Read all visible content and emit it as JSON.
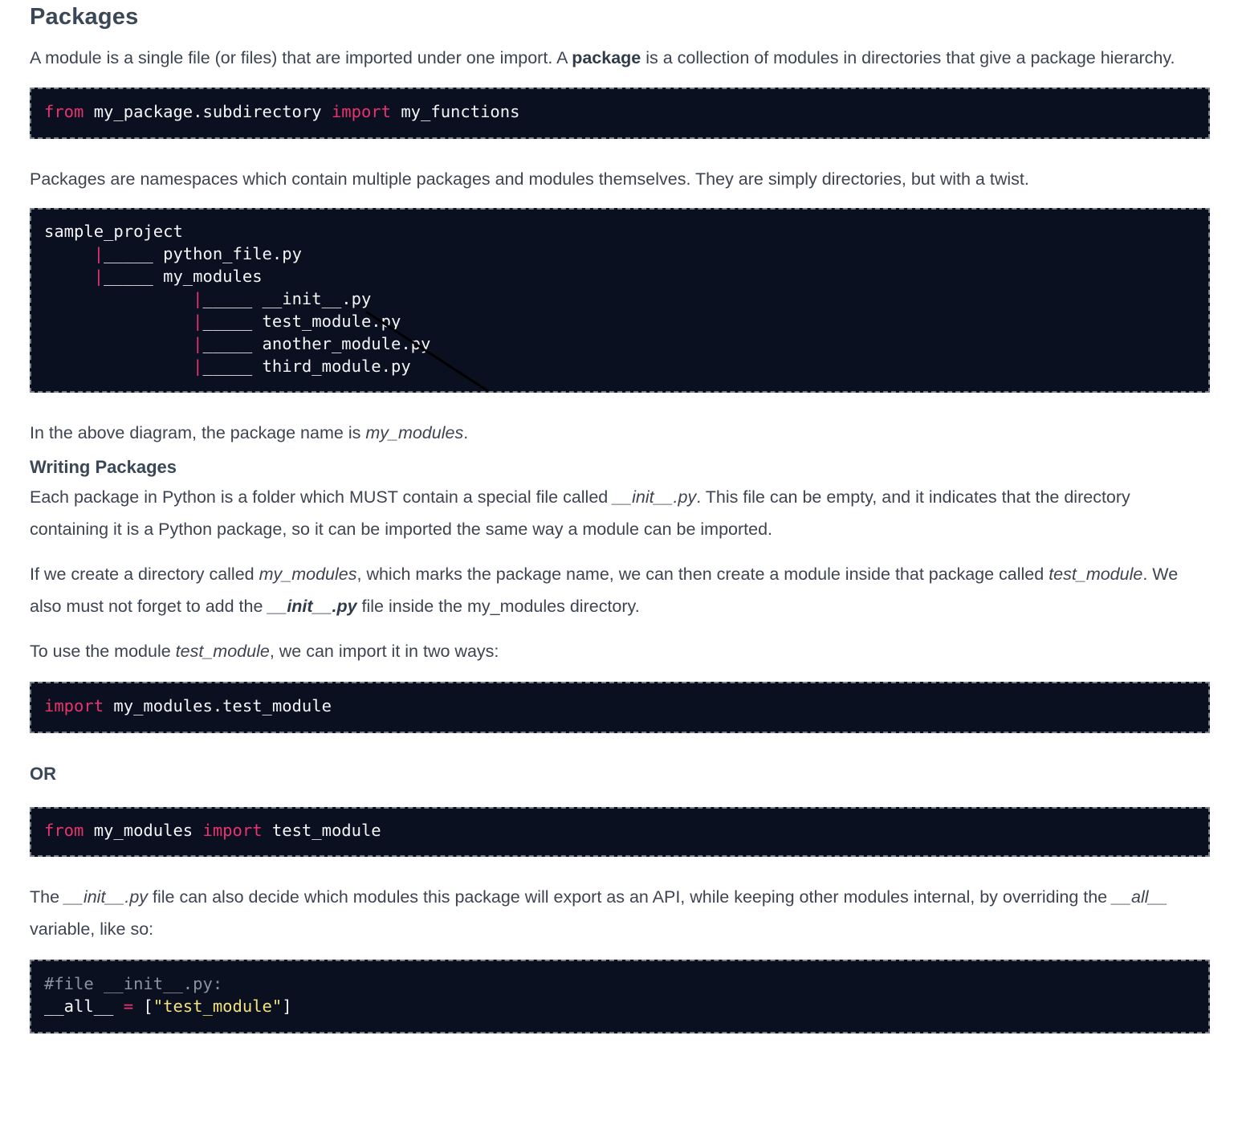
{
  "section": {
    "title": "Packages",
    "intro_before": "A module is a single file (or files) that are imported under one import. A ",
    "intro_bold": "package",
    "intro_after": " is a collection of modules in directories that give a package hierarchy."
  },
  "code1": {
    "kw_from": "from",
    "module": " my_package.subdirectory ",
    "kw_import": "import",
    "name": " my_functions"
  },
  "para_namespaces": "Packages are namespaces which contain multiple packages and modules themselves. They are simply directories, but with a twist.",
  "tree": {
    "root": "sample_project",
    "level1_indent": "     ",
    "level2_indent": "               ",
    "pipe": "|",
    "branch": "_____ ",
    "level1": [
      "python_file.py",
      "my_modules"
    ],
    "level2": [
      "__init__.py",
      "test_module.py",
      "another_module.py",
      "third_module.py"
    ]
  },
  "para_diagram": {
    "before": "In the above diagram, the package name is ",
    "em": "my_modules",
    "after": "."
  },
  "subheading": "Writing Packages",
  "para_each": {
    "before": "Each package in Python is a folder which MUST contain a special file called ",
    "em": "__init__.py",
    "after": ". This file can be empty, and it indicates that the directory containing it is a Python package, so it can be imported the same way a module can be imported."
  },
  "para_if": {
    "p1": "If we create a directory called ",
    "em1": "my_modules",
    "p2": ", which marks the package name, we can then create a module inside that package called ",
    "em2": "test_module",
    "p3": ". We also must not forget to add the ",
    "bem": "__init__.py",
    "p4": " file inside the my_modules directory."
  },
  "para_use": {
    "before": "To use the module ",
    "em": "test_module",
    "after": ", we can import it in two ways:"
  },
  "code2": {
    "kw_import": "import",
    "name": " my_modules.test_module"
  },
  "or_label": "OR",
  "code3": {
    "kw_from": "from",
    "module": " my_modules ",
    "kw_import": "import",
    "name": " test_module"
  },
  "para_all": {
    "p1": "The ",
    "em1": "__init__.py",
    "p2": " file can also decide which modules this package will export as an API, while keeping other modules internal, by overriding the ",
    "em2": "__all__",
    "p3": " variable, like so:"
  },
  "code4": {
    "comment": "#file __init__.py:",
    "var": "__all__ ",
    "op": "=",
    "open": " [",
    "str": "\"test_module\"",
    "close": "]"
  }
}
